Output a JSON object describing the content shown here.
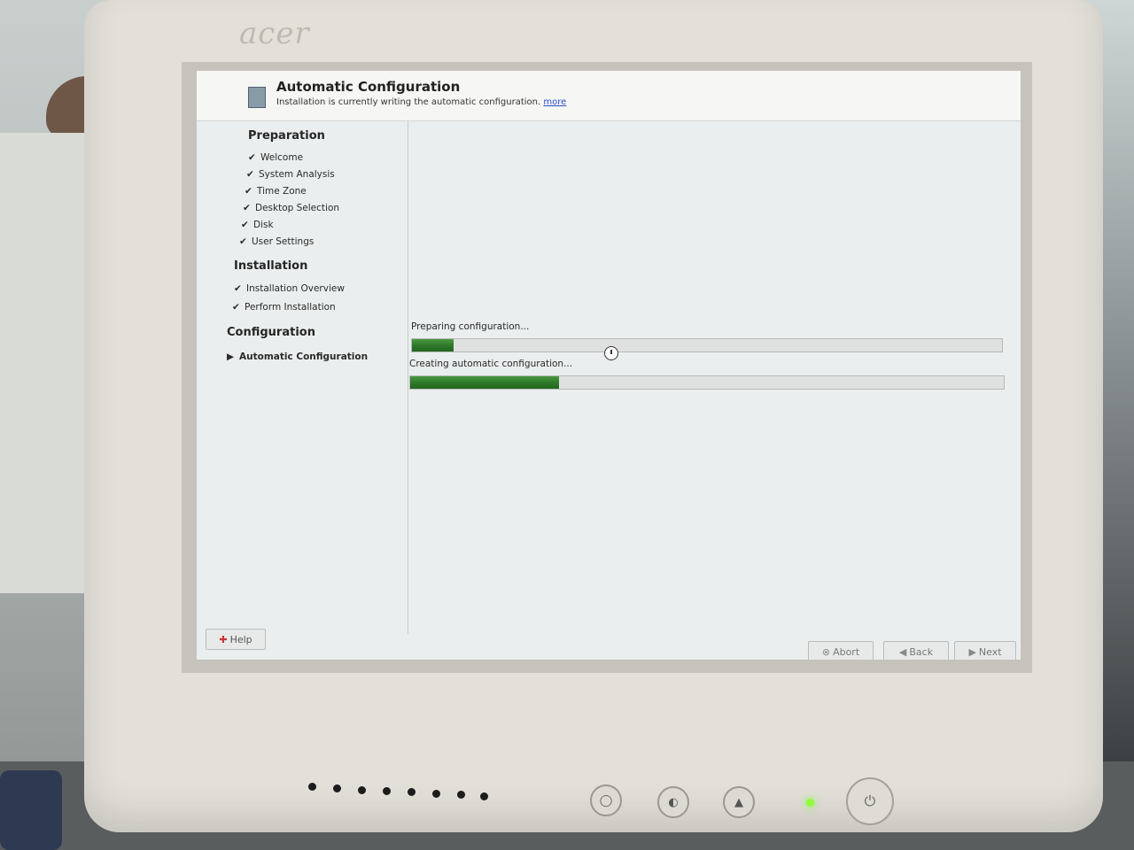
{
  "monitor": {
    "brand": "acer"
  },
  "header": {
    "title": "Automatic Configuration",
    "subtitle": "Installation is currently writing the automatic configuration.",
    "more_link": "more"
  },
  "sidebar": {
    "sections": [
      {
        "heading": "Preparation",
        "items": [
          {
            "label": "Welcome",
            "done": true
          },
          {
            "label": "System Analysis",
            "done": true
          },
          {
            "label": "Time Zone",
            "done": true
          },
          {
            "label": "Desktop Selection",
            "done": true
          },
          {
            "label": "Disk",
            "done": true
          },
          {
            "label": "User Settings",
            "done": true
          }
        ]
      },
      {
        "heading": "Installation",
        "items": [
          {
            "label": "Installation Overview",
            "done": true
          },
          {
            "label": "Perform Installation",
            "done": true
          }
        ]
      },
      {
        "heading": "Configuration",
        "items": [
          {
            "label": "Automatic Configuration",
            "current": true
          }
        ]
      }
    ],
    "check_glyph": "✔",
    "current_glyph": "▶"
  },
  "progress": [
    {
      "label": "Preparing configuration...",
      "fraction": 0.07
    },
    {
      "label": "Creating automatic configuration...",
      "fraction": 0.25
    }
  ],
  "buttons": {
    "help": "Help",
    "abort": "Abort",
    "back": "Back",
    "next": "Next"
  },
  "icons": {
    "header": "installer-icon",
    "help": "help-icon",
    "abort": "abort-icon",
    "back": "back-arrow-icon",
    "next": "next-arrow-icon"
  },
  "colors": {
    "progress_fill": "#2e7a2a",
    "link": "#2a4fd0",
    "power_led": "#8fff3a"
  }
}
